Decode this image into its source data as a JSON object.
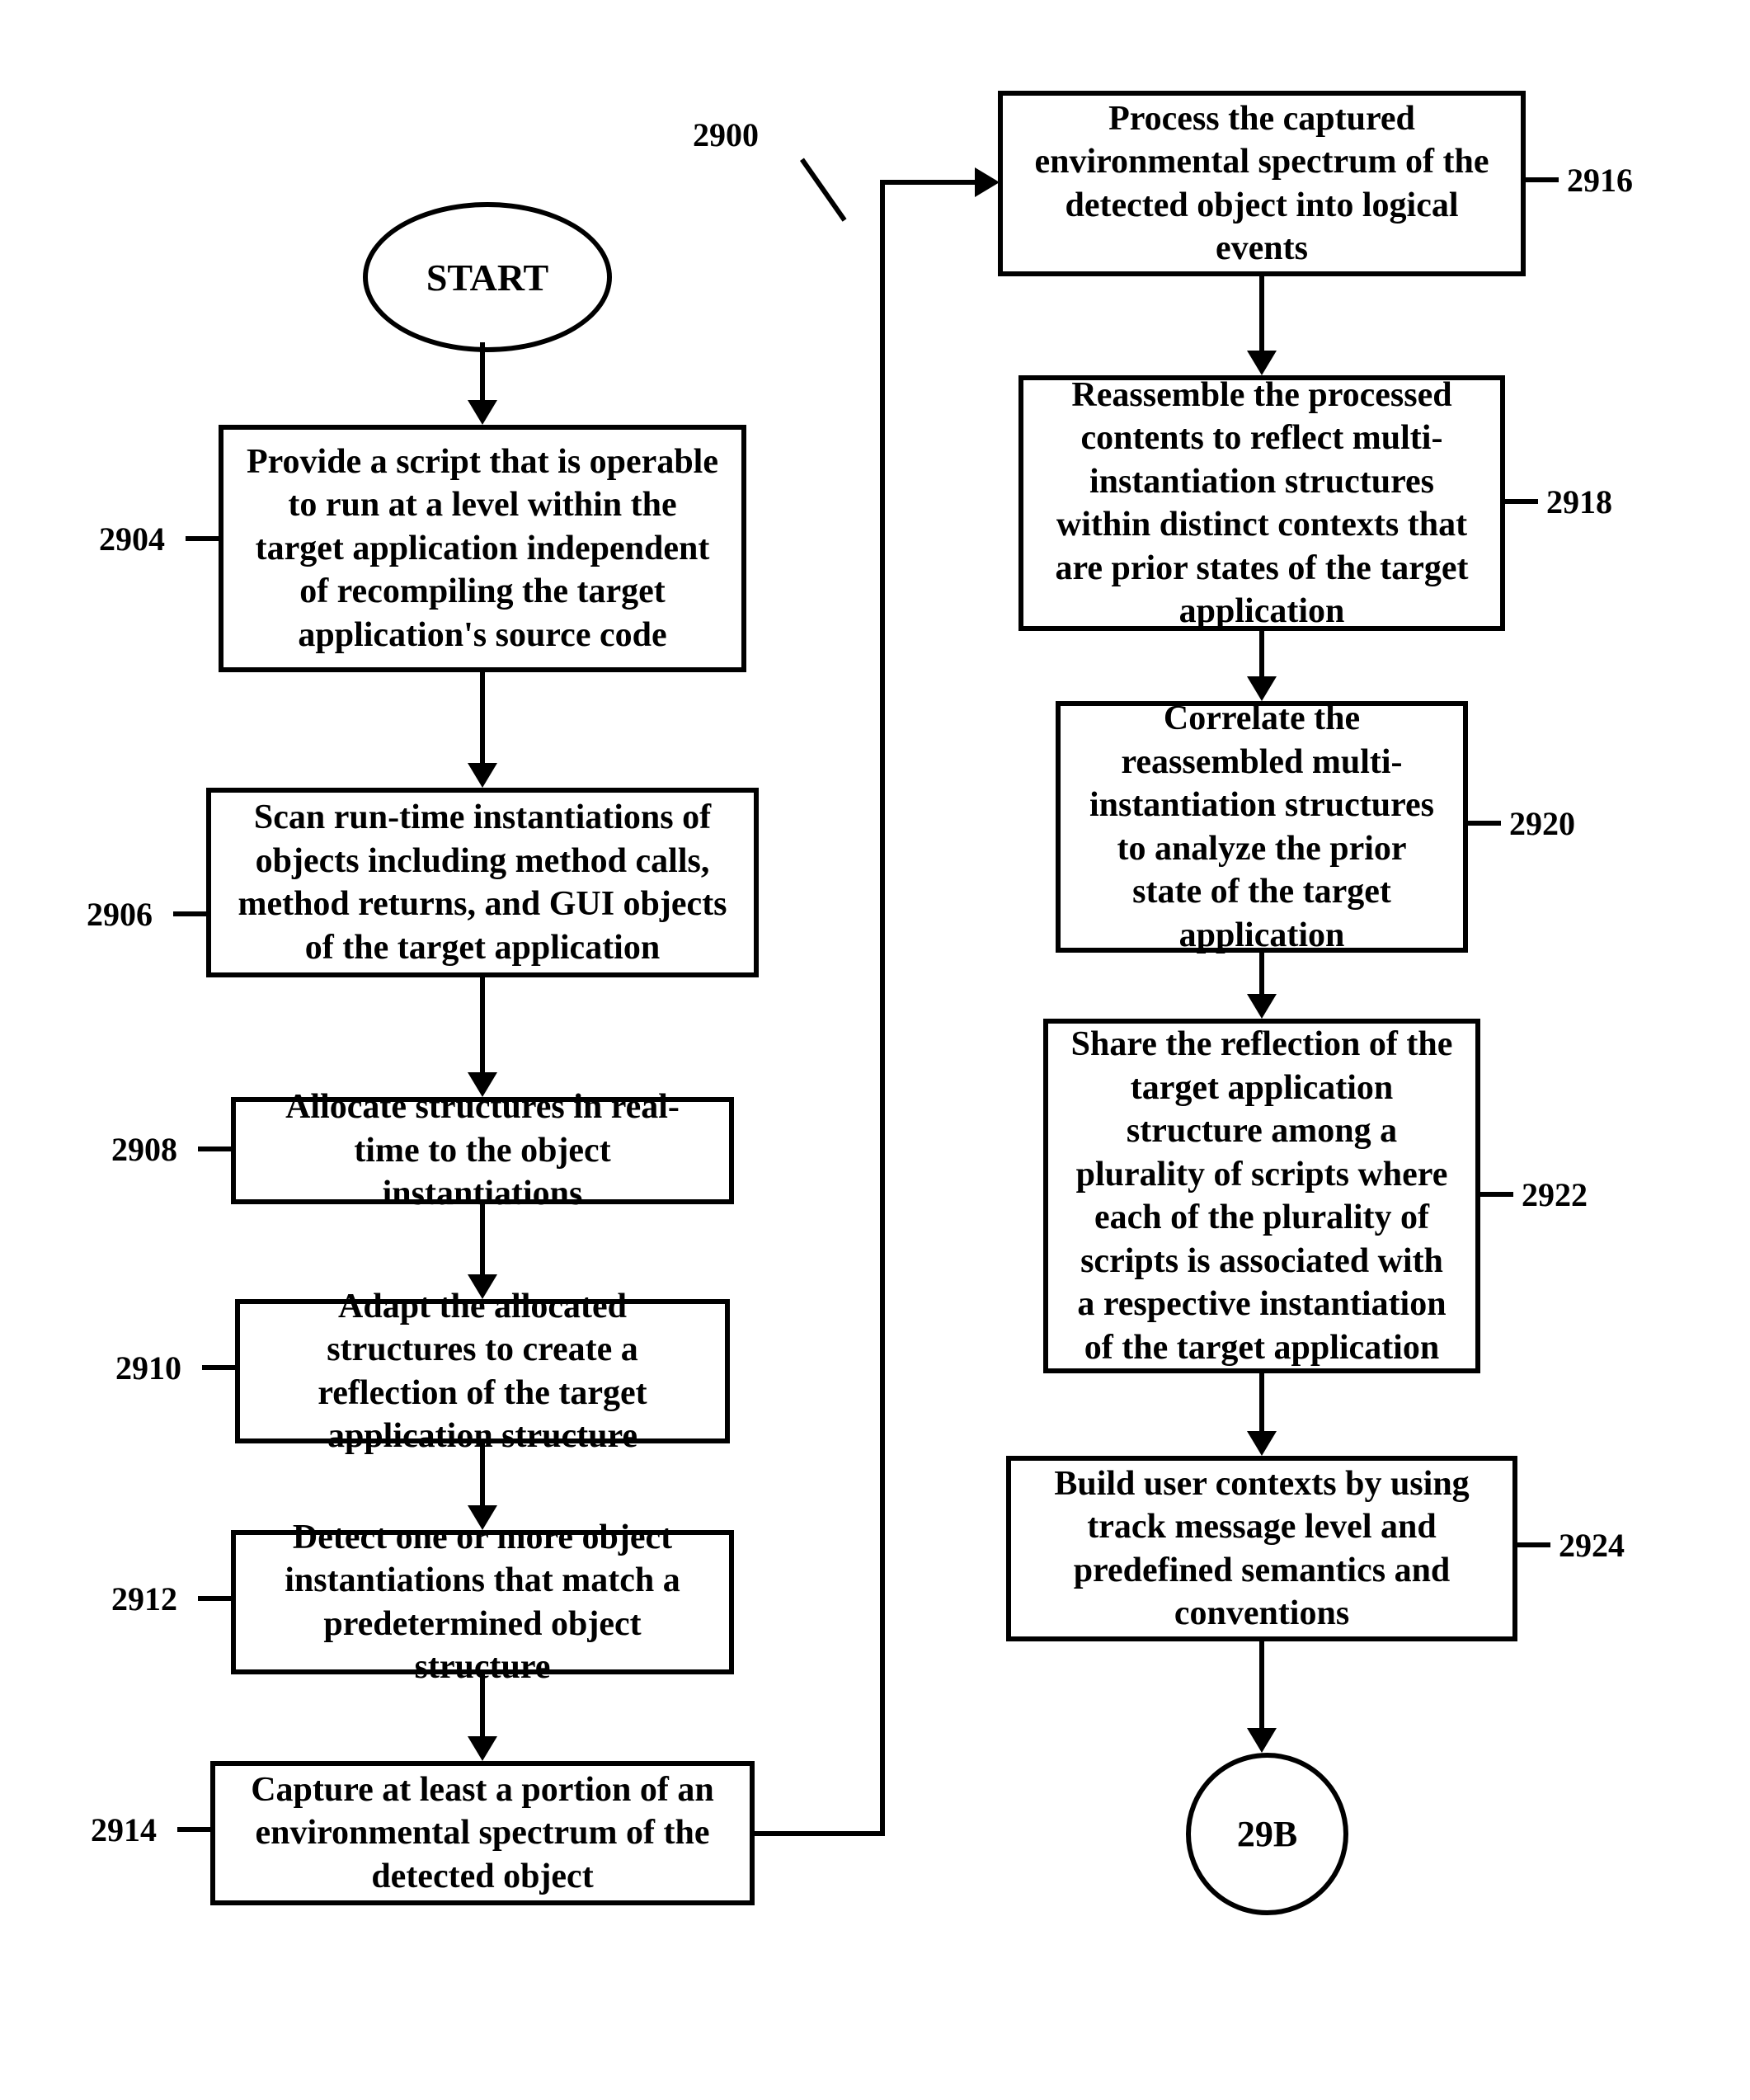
{
  "figure_label": "2900",
  "start_label": "START",
  "connector_label": "29B",
  "left": [
    {
      "ref": "2904",
      "text": "Provide a script that is operable to run at a level within the target application independent of recompiling the target application's source code"
    },
    {
      "ref": "2906",
      "text": "Scan run-time instantiations of objects including method calls, method returns, and GUI objects of the target application"
    },
    {
      "ref": "2908",
      "text": "Allocate structures in real-time to the object instantiations"
    },
    {
      "ref": "2910",
      "text": "Adapt the allocated structures to create a reflection of the target application structure"
    },
    {
      "ref": "2912",
      "text": "Detect one or more object instantiations that match a predetermined object structure"
    },
    {
      "ref": "2914",
      "text": "Capture at least a portion of an environmental spectrum of the detected object"
    }
  ],
  "right": [
    {
      "ref": "2916",
      "text": "Process the captured environmental spectrum of the detected object into logical events"
    },
    {
      "ref": "2918",
      "text": "Reassemble the processed contents to reflect multi-instantiation structures within distinct contexts that are prior states of the target application"
    },
    {
      "ref": "2920",
      "text": "Correlate the reassembled multi-instantiation structures to analyze the prior state of the target application"
    },
    {
      "ref": "2922",
      "text": "Share the reflection of the target application structure among a plurality of scripts where each of the plurality of scripts is associated with a respective instantiation of the target application"
    },
    {
      "ref": "2924",
      "text": "Build user contexts by using track message level and predefined semantics and conventions"
    }
  ]
}
